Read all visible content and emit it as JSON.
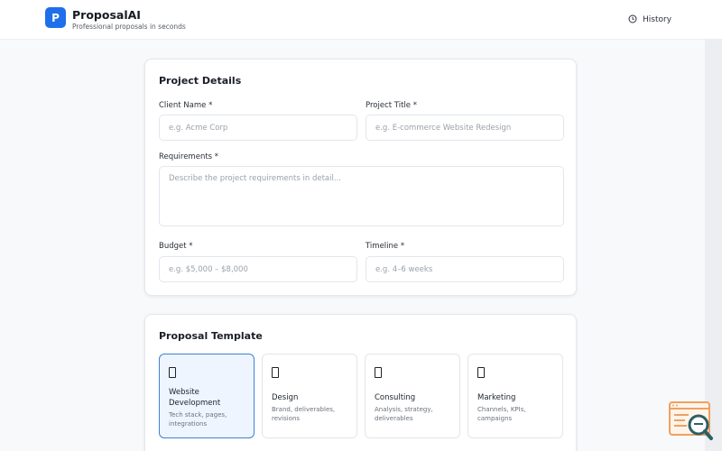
{
  "app": {
    "logo_letter": "P",
    "name": "ProposalAI",
    "tagline": "Professional proposals in seconds",
    "history_label": "History",
    "accent": "#1f6feb"
  },
  "details": {
    "title": "Project Details",
    "client_name": {
      "label": "Client Name *",
      "placeholder": "e.g. Acme Corp",
      "value": ""
    },
    "project_title": {
      "label": "Project Title *",
      "placeholder": "e.g. E-commerce Website Redesign",
      "value": ""
    },
    "requirements": {
      "label": "Requirements *",
      "placeholder": "Describe the project requirements in detail...",
      "value": ""
    },
    "budget": {
      "label": "Budget *",
      "placeholder": "e.g. $5,000 – $8,000",
      "value": ""
    },
    "timeline": {
      "label": "Timeline *",
      "placeholder": "e.g. 4–6 weeks",
      "value": ""
    }
  },
  "template": {
    "title": "Proposal Template",
    "options": [
      {
        "name": "Website Development",
        "desc": "Tech stack, pages, integrations",
        "icon": "document-icon",
        "selected": true
      },
      {
        "name": "Design",
        "desc": "Brand, deliverables, revisions",
        "icon": "document-icon",
        "selected": false
      },
      {
        "name": "Consulting",
        "desc": "Analysis, strategy, deliverables",
        "icon": "document-icon",
        "selected": false
      },
      {
        "name": "Marketing",
        "desc": "Channels, KPIs, campaigns",
        "icon": "document-icon",
        "selected": false
      }
    ]
  },
  "colors": {
    "selected_border": "#3b82d6",
    "selected_bg": "#eef5fe",
    "widget_orange": "#f0a060",
    "widget_teal": "#2d5f66"
  }
}
